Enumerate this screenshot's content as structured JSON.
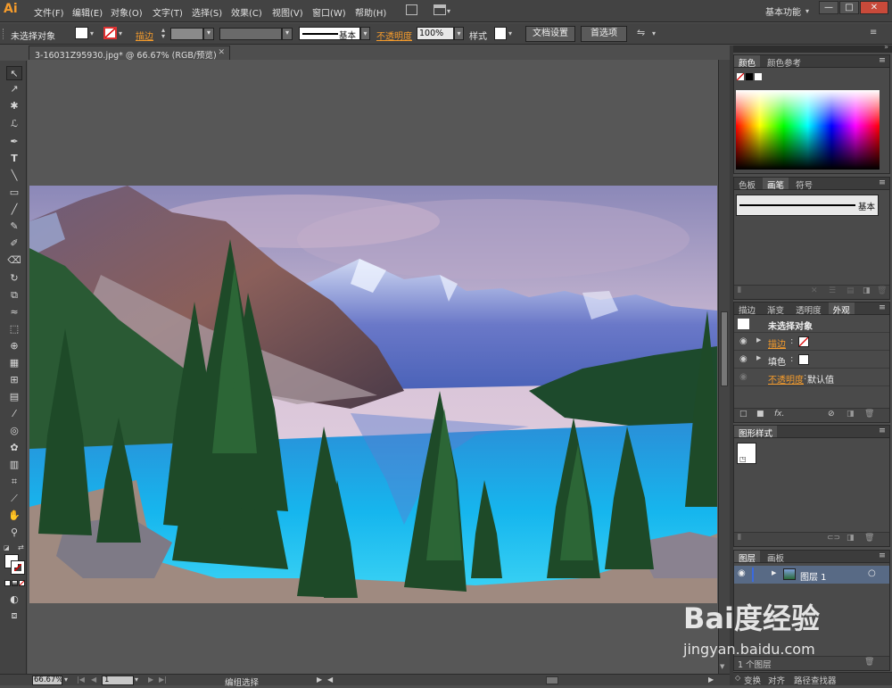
{
  "app": {
    "logo": "Ai"
  },
  "menu": [
    "文件(F)",
    "编辑(E)",
    "对象(O)",
    "文字(T)",
    "选择(S)",
    "效果(C)",
    "视图(V)",
    "窗口(W)",
    "帮助(H)"
  ],
  "workspace": "基本功能",
  "control": {
    "selection": "未选择对象",
    "stroke_label": "描边",
    "stroke_style": "基本",
    "opacity_label": "不透明度",
    "opacity_value": "100%",
    "style_label": "样式",
    "doc_setup": "文档设置",
    "preferences": "首选项"
  },
  "document": {
    "tab_title": "3-16031Z95930.jpg* @ 66.67% (RGB/预览)"
  },
  "statusbar": {
    "zoom": "66.67%",
    "artboard": "1",
    "status": "编组选择"
  },
  "panels": {
    "color": {
      "tabs": [
        "颜色",
        "颜色参考"
      ]
    },
    "brushes": {
      "tabs": [
        "色板",
        "画笔",
        "符号"
      ],
      "brush_name": "基本"
    },
    "appearance": {
      "tabs": [
        "描边",
        "渐变",
        "透明度",
        "外观"
      ],
      "title": "未选择对象",
      "stroke_label": "描边",
      "fill_label": "填色",
      "opacity_label": "不透明度",
      "opacity_value": "默认值"
    },
    "graphic_styles": {
      "tabs": [
        "图形样式"
      ]
    },
    "layers": {
      "tabs": [
        "图层",
        "画板"
      ],
      "layer_name": "图层 1",
      "count": "1 个图层"
    },
    "bottom": {
      "tabs": [
        "变换",
        "对齐",
        "路径查找器"
      ]
    }
  },
  "watermark": {
    "logo": "Bai度经验",
    "url": "jingyan.baidu.com"
  }
}
